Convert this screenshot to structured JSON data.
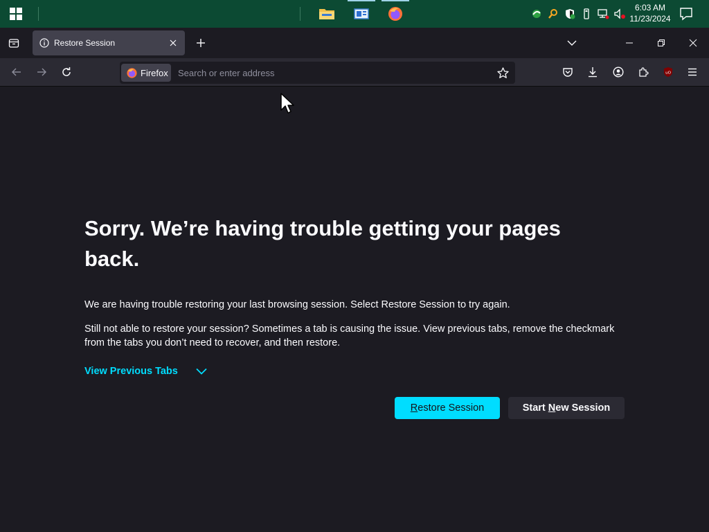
{
  "taskbar": {
    "clock_time": "6:03 AM",
    "clock_date": "11/23/2024",
    "apps": [
      "file-explorer",
      "news-app",
      "firefox"
    ]
  },
  "browser": {
    "tab_title": "Restore Session",
    "identity_label": "Firefox",
    "address_placeholder": "Search or enter address"
  },
  "page": {
    "title": "Sorry. We’re having trouble getting your pages back.",
    "paragraph1": "We are having trouble restoring your last browsing session. Select Restore Session to try again.",
    "paragraph2": "Still not able to restore your session? Sometimes a tab is causing the issue. View previous tabs, remove the checkmark from the tabs you don’t need to recover, and then restore.",
    "view_previous_tabs": "View Previous Tabs",
    "restore_button": {
      "accesskey": "R",
      "rest": "estore Session"
    },
    "new_session_button": {
      "before": "Start ",
      "accesskey": "N",
      "after": "ew Session"
    }
  },
  "colors": {
    "accent": "#00ddff",
    "background": "#1c1b22",
    "taskbar": "#0c4a33"
  }
}
